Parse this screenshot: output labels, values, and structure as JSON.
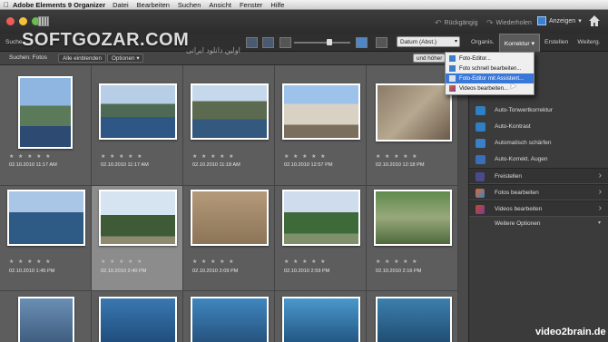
{
  "menubar": {
    "app": "Adobe Elements 9 Organizer",
    "items": [
      "Datei",
      "Bearbeiten",
      "Suchen",
      "Ansicht",
      "Fenster",
      "Hilfe"
    ]
  },
  "toolbar": {
    "undo": "Rückgängig",
    "redo": "Wiederholen",
    "show": "Anzeigen",
    "colors": {
      "close": "#ec5d57",
      "min": "#f5c03d",
      "max": "#6abf4b",
      "accent": "#3878d8"
    }
  },
  "watermark": {
    "text": "SOFTGOZAR.COM",
    "sub": "اولین دانلود ایرانی"
  },
  "bar2": {
    "search_label": "Suche",
    "sort": "Datum (Abst.)",
    "tabs": [
      "Organis.",
      "Korrektur",
      "Erstellen",
      "Weiterg."
    ]
  },
  "filter": {
    "label": "Suchen: Fotos",
    "show_all": "Alle einblenden",
    "options": "Optionen",
    "and_higher": "und höher"
  },
  "menu": {
    "items": [
      {
        "label": "Foto-Editor...",
        "icon": "photo-editor-icon"
      },
      {
        "label": "Foto schnell bearbeiten...",
        "icon": "quick-edit-icon"
      },
      {
        "label": "Foto-Editor mit Assistent...",
        "icon": "guided-edit-icon"
      },
      {
        "label": "Videos bearbeiten...",
        "icon": "video-edit-icon"
      }
    ]
  },
  "panel": {
    "items": [
      {
        "label": "Auto-Tonwertkorrektur",
        "icon": "auto-levels-icon"
      },
      {
        "label": "Auto-Kontrast",
        "icon": "auto-contrast-icon"
      },
      {
        "label": "Automatisch schärfen",
        "icon": "auto-sharpen-icon"
      },
      {
        "label": "Auto-Korrekt. Augen",
        "icon": "red-eye-icon"
      }
    ],
    "sections": [
      {
        "label": "Freistellen",
        "icon": "crop-icon"
      },
      {
        "label": "Fotos bearbeiten",
        "icon": "edit-photos-icon"
      },
      {
        "label": "Videos bearbeiten",
        "icon": "edit-videos-icon"
      }
    ],
    "more": "Weitere Optionen"
  },
  "photos": {
    "row1": [
      "02.10.2010 11:17 AM",
      "02.10.2010 11:17 AM",
      "02.10.2010 11:18 AM",
      "02.10.2010 12:57 PM",
      "02.10.2010 12:18 PM"
    ],
    "row2": [
      "02.10.2010 1:45 PM",
      "02.10.2010 2:40 PM",
      "02.10.2010 2:09 PM",
      "02.10.2010 2:59 PM",
      "02.10.2010 2:16 PM"
    ],
    "stars": "★ ★ ★ ★ ★"
  },
  "brand": "video2brain.de"
}
